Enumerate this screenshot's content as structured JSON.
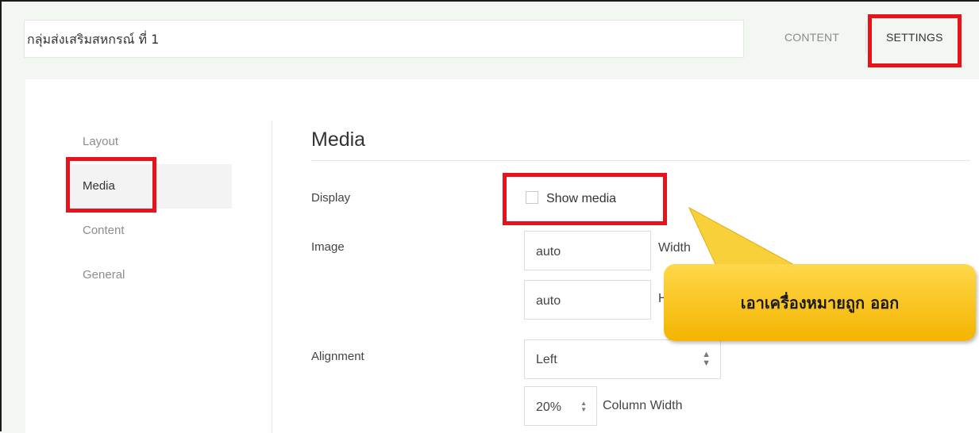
{
  "header": {
    "title": "กลุ่มส่งเสริมสหกรณ์ ที่ 1",
    "tabs": [
      {
        "label": "CONTENT"
      },
      {
        "label": "SETTINGS"
      }
    ]
  },
  "sidebar": {
    "items": [
      {
        "label": "Layout"
      },
      {
        "label": "Media"
      },
      {
        "label": "Content"
      },
      {
        "label": "General"
      }
    ],
    "active": "Media"
  },
  "media": {
    "title": "Media",
    "display_label": "Display",
    "show_media_label": "Show media",
    "show_media_checked": false,
    "image_label": "Image",
    "width_value": "auto",
    "width_label": "Width",
    "height_value": "auto",
    "height_label": "H",
    "alignment_label": "Alignment",
    "alignment_value": "Left",
    "column_width_value": "20%",
    "column_width_label": "Column Width"
  },
  "annotation": {
    "callout_text": "เอาเครื่องหมายถูก ออก",
    "highlight_color": "#e8121a",
    "callout_color": "#f7c21a"
  }
}
